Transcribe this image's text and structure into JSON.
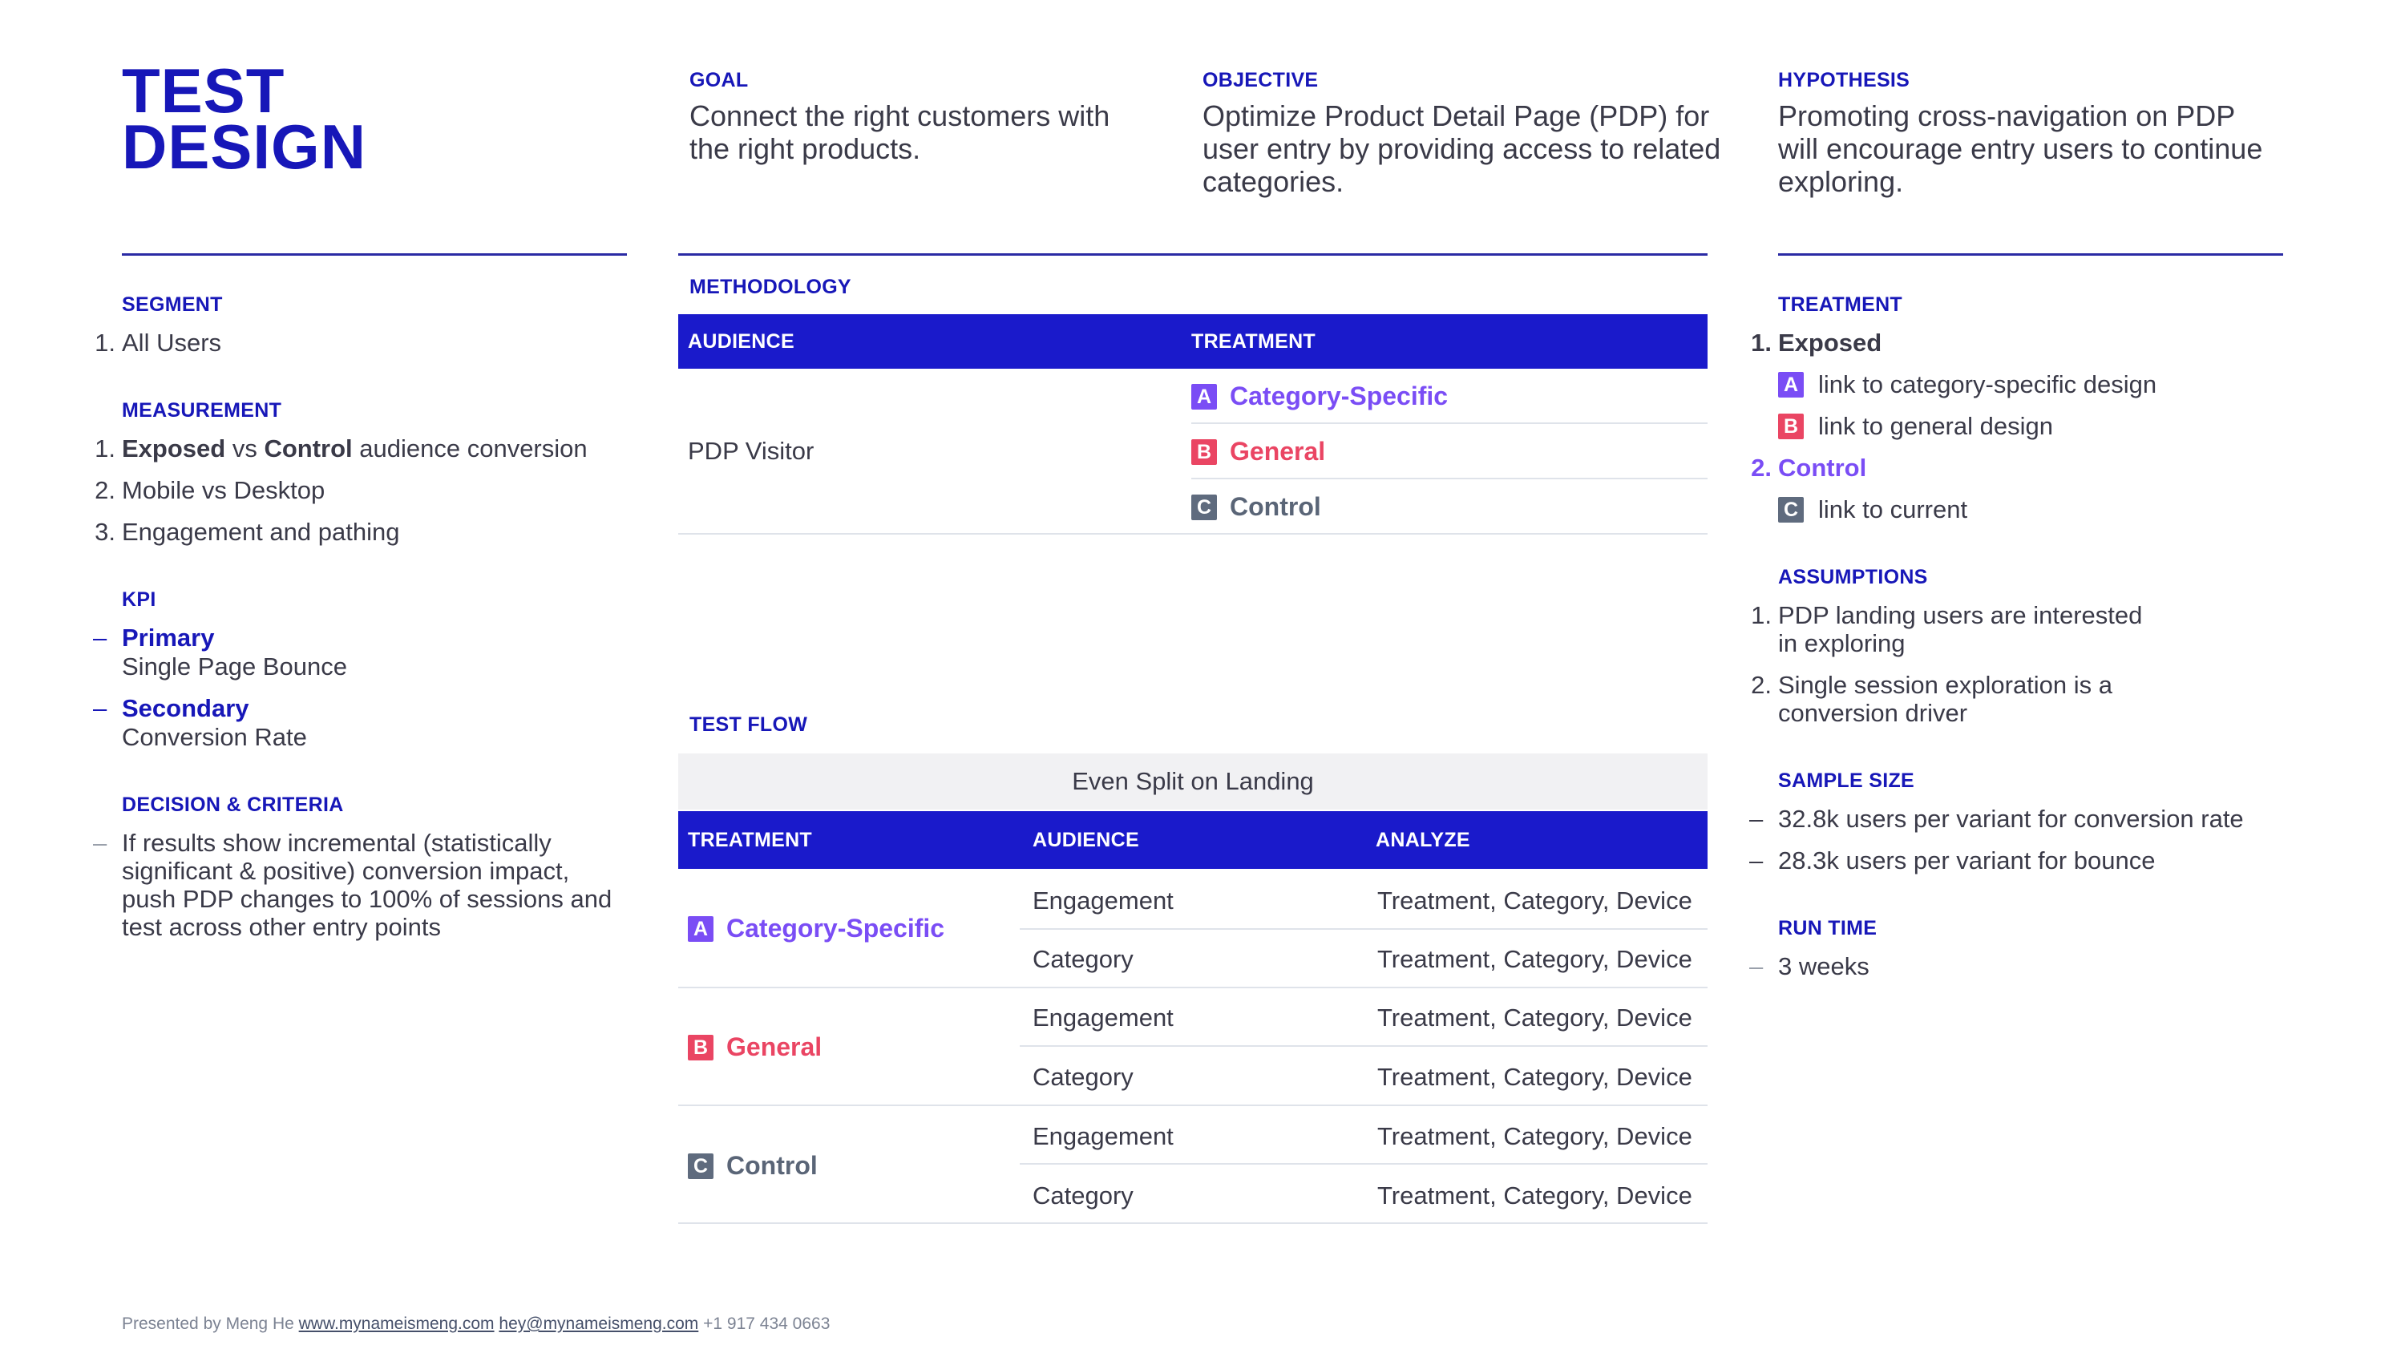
{
  "title": {
    "line1": "TEST",
    "line2": "DESIGN"
  },
  "goal": {
    "label": "GOAL",
    "text": "Connect the right customers with the right products."
  },
  "objective": {
    "label": "OBJECTIVE",
    "text": "Optimize Product Detail Page (PDP) for user entry by providing access to related categories."
  },
  "hypothesis": {
    "label": "HYPOTHESIS",
    "text": "Promoting cross-navigation on PDP will encourage entry users to continue exploring."
  },
  "segment": {
    "label": "SEGMENT",
    "items": [
      {
        "n": "1.",
        "text": "All Users"
      }
    ]
  },
  "measurement": {
    "label": "MEASUREMENT",
    "items": [
      {
        "n": "1.",
        "bold1": "Exposed",
        "mid": " vs ",
        "bold2": "Control",
        "rest": " audience conversion"
      },
      {
        "n": "2.",
        "text": "Mobile vs Desktop"
      },
      {
        "n": "3.",
        "text": "Engagement and pathing"
      }
    ]
  },
  "kpi": {
    "label": "KPI",
    "items": [
      {
        "dash": "–",
        "name": "Primary",
        "desc": "Single Page Bounce"
      },
      {
        "dash": "–",
        "name": "Secondary",
        "desc": "Conversion Rate"
      }
    ]
  },
  "decision": {
    "label": "DECISION & CRITERIA",
    "dash": "–",
    "lines": [
      "If results show incremental (statistically",
      "significant & positive) conversion impact,",
      "push PDP changes to 100% of sessions and",
      "test across other entry points"
    ]
  },
  "methodology": {
    "label": "METHODOLOGY",
    "headers": {
      "audience": "AUDIENCE",
      "treatment": "TREATMENT"
    },
    "audience": "PDP Visitor",
    "treatments": [
      {
        "letter": "A",
        "name": "Category-Specific",
        "color": "#7a4df5"
      },
      {
        "letter": "B",
        "name": "General",
        "color": "#ea4563"
      },
      {
        "letter": "C",
        "name": "Control",
        "color": "#5a6577"
      }
    ]
  },
  "test_flow": {
    "label": "TEST FLOW",
    "split": "Even Split on Landing",
    "headers": {
      "treatment": "TREATMENT",
      "audience": "AUDIENCE",
      "analyze": "ANALYZE"
    },
    "groups": [
      {
        "letter": "A",
        "name": "Category-Specific",
        "rows": [
          {
            "audience": "Engagement",
            "analyze": "Treatment, Category, Device"
          },
          {
            "audience": "Category",
            "analyze": "Treatment, Category, Device"
          }
        ]
      },
      {
        "letter": "B",
        "name": "General",
        "rows": [
          {
            "audience": "Engagement",
            "analyze": "Treatment, Category, Device"
          },
          {
            "audience": "Category",
            "analyze": "Treatment, Category, Device"
          }
        ]
      },
      {
        "letter": "C",
        "name": "Control",
        "rows": [
          {
            "audience": "Engagement",
            "analyze": "Treatment, Category, Device"
          },
          {
            "audience": "Category",
            "analyze": "Treatment, Category, Device"
          }
        ]
      }
    ]
  },
  "treatment": {
    "label": "TREATMENT",
    "exposed": {
      "n": "1.",
      "name": "Exposed"
    },
    "exposed_items": [
      {
        "letter": "A",
        "text": "link to category-specific design"
      },
      {
        "letter": "B",
        "text": "link to general design"
      }
    ],
    "control": {
      "n": "2.",
      "name": "Control"
    },
    "control_items": [
      {
        "letter": "C",
        "text": "link to current"
      }
    ]
  },
  "assumptions": {
    "label": "ASSUMPTIONS",
    "items": [
      {
        "n": "1.",
        "line1": "PDP landing users are interested",
        "line2": "in exploring"
      },
      {
        "n": "2.",
        "line1": "Single session exploration is a",
        "line2": "conversion driver"
      }
    ]
  },
  "sample_size": {
    "label": "SAMPLE SIZE",
    "items": [
      {
        "dash": "–",
        "text": "32.8k users per variant for conversion rate"
      },
      {
        "dash": "–",
        "text": "28.3k users per variant for bounce"
      }
    ]
  },
  "run_time": {
    "label": "RUN TIME",
    "dash": "–",
    "text": "3 weeks"
  },
  "footer": {
    "prefix": "Presented by Meng He",
    "website": "www.mynameismeng.com",
    "email": "hey@mynameismeng.com",
    "phone": "+1 917 434 0663"
  }
}
